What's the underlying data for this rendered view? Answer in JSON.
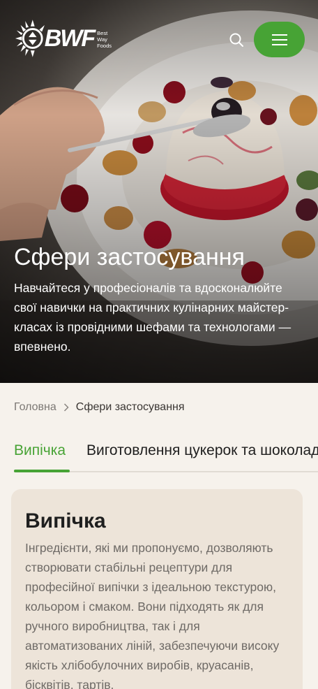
{
  "header": {
    "logo_text": "BWF",
    "logo_sub": [
      "Best",
      "Way",
      "Foods"
    ],
    "search_icon": "search-icon",
    "menu_icon": "hamburger-icon",
    "accent": "#47a335"
  },
  "hero": {
    "title": "Сфери застосування",
    "text": "Навчайтеся у професіоналів та вдосконалюйте свої навички на практичних кулінарних майстер-класах із провідними шефами та технологами — впевнено."
  },
  "breadcrumb": {
    "home": "Головна",
    "separator_icon": "chevron-right-icon",
    "current": "Сфери застосування"
  },
  "tabs": [
    {
      "label": "Випічка",
      "active": true
    },
    {
      "label": "Виготовлення цукерок та шоколаду",
      "active": false
    }
  ],
  "card": {
    "title": "Випічка",
    "text": "Інгредієнти, які ми пропонуємо, дозволяють створювати стабільні рецептури для професійної випічки з ідеальною текстурою, кольором і смаком. Вони підходять як для ручного виробництва, так і для автоматизованих ліній, забезпечуючи високу якість хлібобулочних виробів, круасанів, бісквітів, тартів."
  }
}
